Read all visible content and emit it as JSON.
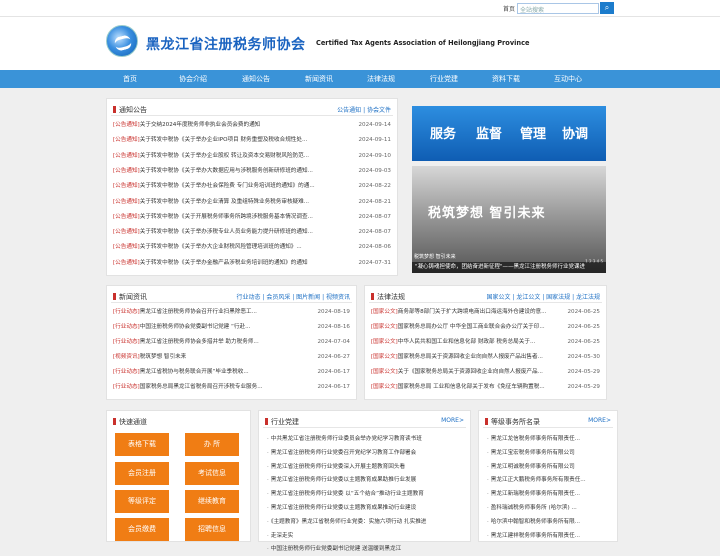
{
  "topbar": {
    "home_label": "首页",
    "search_placeholder": "全站搜索",
    "search_icon": "search-icon"
  },
  "header": {
    "cn_title": "黑龙江省注册税务师协会",
    "en_title": "Certified Tax Agents Association of Heilongjiang Province"
  },
  "nav": [
    "首页",
    "协会介绍",
    "通知公告",
    "新闻资讯",
    "法律法规",
    "行业党建",
    "资料下载",
    "互动中心"
  ],
  "notices": {
    "title": "通知公告",
    "more": "公告通知 | 协会文件",
    "items": [
      {
        "tag": "[公告通知]",
        "text": "关于交纳2024年度税务师非执业会员会费的通知",
        "date": "2024-09-14"
      },
      {
        "tag": "[公告通知]",
        "text": "关于转发中税协《关于举办企业IPO项目 财务重塑及税收合规性处...",
        "date": "2024-09-11"
      },
      {
        "tag": "[公告通知]",
        "text": "关于转发中税协《关于举办企业股权 转让及资本交易财税风险防范...",
        "date": "2024-09-10"
      },
      {
        "tag": "[公告通知]",
        "text": "关于转发中税协《关于举办大数据应用与涉税服务创新研修班的通知...",
        "date": "2024-09-03"
      },
      {
        "tag": "[公告通知]",
        "text": "关于转发中税协《关于举办社会保险费 专门业务培训班的通知》的通...",
        "date": "2024-08-22"
      },
      {
        "tag": "[公告通知]",
        "text": "关于转发中税协《关于举办企业清算 及重组特殊业务税务审核疑难...",
        "date": "2024-08-21"
      },
      {
        "tag": "[公告通知]",
        "text": "关于转发中税协《关于开展税务师事务所跨境涉税服务基本情况调查...",
        "date": "2024-08-07"
      },
      {
        "tag": "[公告通知]",
        "text": "关于转发中税协《关于举办涉税专业人员业务能力提升研修班的通知...",
        "date": "2024-08-07"
      },
      {
        "tag": "[公告通知]",
        "text": "关于转发中税协《关于举办大企业财税风险管理培训班的通知》...",
        "date": "2024-08-06"
      },
      {
        "tag": "[公告通知]",
        "text": "关于转发中税协《关于举办金融产品涉税业务培训班的通知》的通知",
        "date": "2024-07-31"
      }
    ]
  },
  "banner1": {
    "words": [
      "服务",
      "监督",
      "管理",
      "协调"
    ]
  },
  "banner2": {
    "text": "税筑梦想 智引未来",
    "caption": "\"凝心铸魂担使命，团结奋进新征程\"——黑龙江注册税务师行业党课进",
    "mini": "税筑梦想 智引未来",
    "index": "1 2 3 4 5"
  },
  "news": {
    "title": "新闻资讯",
    "more": "行业动态 | 会员风采 | 图片新闻 | 视频资讯",
    "items": [
      {
        "tag": "[行业动态]",
        "text": "黑龙江省注册税务师协会召开行业扫黑除恶工...",
        "date": "2024-08-19"
      },
      {
        "tag": "[行业动态]",
        "text": "中国注册税务师协会党委副书记党建 “行赴...",
        "date": "2024-08-16"
      },
      {
        "tag": "[行业动态]",
        "text": "黑龙江省注册税务师协会多措并举 助力税务师...",
        "date": "2024-07-04"
      },
      {
        "tag": "[视频资讯]",
        "text": "税筑梦想 智引未来",
        "date": "2024-06-27"
      },
      {
        "tag": "[行业动态]",
        "text": "黑龙江省税协与税务联合开展“毕业季税收...",
        "date": "2024-06-17"
      },
      {
        "tag": "[行业动态]",
        "text": "国家税务总局黑龙江省税务局召开涉税专业服务...",
        "date": "2024-06-17"
      }
    ]
  },
  "laws": {
    "title": "法律法规",
    "more": "国家公文 | 龙江公文 | 国家法规 | 龙江法规",
    "items": [
      {
        "tag": "[国家公文]",
        "text": "商务部等8部门关于扩大跨境电商出口海运海外仓建设的意...",
        "date": "2024-06-25"
      },
      {
        "tag": "[国家公文]",
        "text": "国家税务总局办公厅 中华全国工商业联合会办公厅关于印...",
        "date": "2024-06-25"
      },
      {
        "tag": "[国家公文]",
        "text": "中华人民共和国工业和信息化部 财政部 税务总局关于...",
        "date": "2024-06-25"
      },
      {
        "tag": "[国家公文]",
        "text": "国家税务总局关于资源回收企业向自然人报废产品出售者...",
        "date": "2024-05-30"
      },
      {
        "tag": "[国家公文]",
        "text": "关于《国家税务总局关于资源回收企业向自然人报废产品...",
        "date": "2024-05-29"
      },
      {
        "tag": "[国家公文]",
        "text": "国家税务总局 工业和信息化部关于发布《免征车辆购置税...",
        "date": "2024-05-29"
      }
    ]
  },
  "quick": {
    "title": "快速通道",
    "buttons": [
      "表格下载",
      "办 所",
      "会员注册",
      "考试信息",
      "等级评定",
      "继续教育",
      "会员缴费",
      "招聘信息"
    ]
  },
  "party": {
    "title": "行业党建",
    "more": "MORE>",
    "items": [
      "中共黑龙江省注册税务师行业委员会举办党纪学习教育读书班",
      "黑龙江省注册税务师行业党委召开党纪学习教育工作部署会",
      "黑龙江省注册税务师行业党委深入开展主题教育回头看",
      "黑龙江省注册税务师行业党委以主题教育成果助推行业发展",
      "黑龙江省注册税务师行业党委 以“五个结合”推动行业主题教育",
      "黑龙江省注册税务师行业党委以主题教育成果推动行业建设",
      "《主题教育》黑龙江省税务师行业党委：实施六项行动 扎实推进",
      "走深走实",
      "中国注册税务师行业党委副书记党建 送温暖到黑龙江"
    ]
  },
  "firms": {
    "title": "等级事务所名录",
    "more": "MORE>",
    "items": [
      "黑龙江龙信税务师事务所有限责任...",
      "黑龙江宝宏税务师事务所有限公司",
      "黑龙江明诚税务师事务所有限公司",
      "黑龙江正大鹏税务师事务所有限责任...",
      "黑龙江新瑞税务师事务所有限责任...",
      "盈科瑞诚税务师事务所 (哈尔滨) ...",
      "哈尔滨中翰智和税务师事务所有限...",
      "黑龙江建祥税务师事务所有限责任..."
    ]
  },
  "colors": {
    "nav_blue": "#3a93d8",
    "brand_blue": "#1a63c0",
    "tag_red": "#c9302c",
    "button_orange": "#f07d14"
  }
}
